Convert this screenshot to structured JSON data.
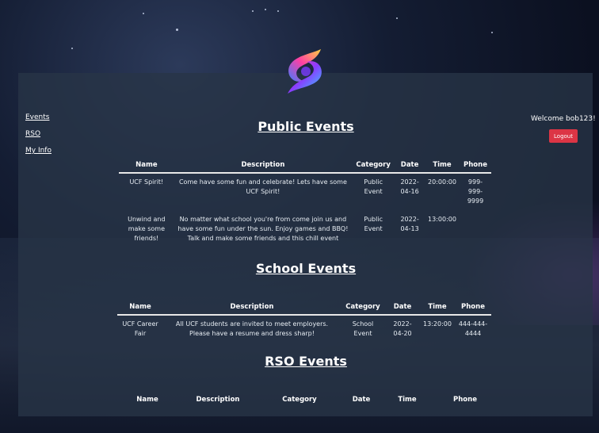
{
  "nav": {
    "events": "Events",
    "rso": "RSO",
    "myinfo": "My Info"
  },
  "user": {
    "welcome": "Welcome bob123!",
    "logout": "Logout"
  },
  "public": {
    "title": "Public Events",
    "headers": [
      "Name",
      "Description",
      "Category",
      "Date",
      "Time",
      "Phone"
    ],
    "rows": [
      {
        "name": "UCF Spirit!",
        "description": "Come have some fun and celebrate! Lets have some UCF Spirit!",
        "category": "Public Event",
        "date": "2022-04-16",
        "time": "20:00:00",
        "phone": "999-999-9999"
      },
      {
        "name": "Unwind and make some friends!",
        "description": "No matter what school you're from come join us and have some fun under the sun. Enjoy games and BBQ! Talk and make some friends and this chill event",
        "category": "Public Event",
        "date": "2022-04-13",
        "time": "13:00:00",
        "phone": ""
      }
    ]
  },
  "school": {
    "title": "School Events",
    "headers": [
      "Name",
      "Description",
      "Category",
      "Date",
      "Time",
      "Phone"
    ],
    "rows": [
      {
        "name": "UCF Career Fair",
        "description": "All UCF students are invited to meet employers. Please have a resume and dress sharp!",
        "category": "School Event",
        "date": "2022-04-20",
        "time": "13:20:00",
        "phone": "444-444-4444"
      }
    ]
  },
  "rso": {
    "title": "RSO Events",
    "headers": [
      "Name",
      "Description",
      "Category",
      "Date",
      "Time",
      "Phone"
    ]
  },
  "colors": {
    "logout_bg": "#dc3545",
    "panel": "#28344a"
  }
}
